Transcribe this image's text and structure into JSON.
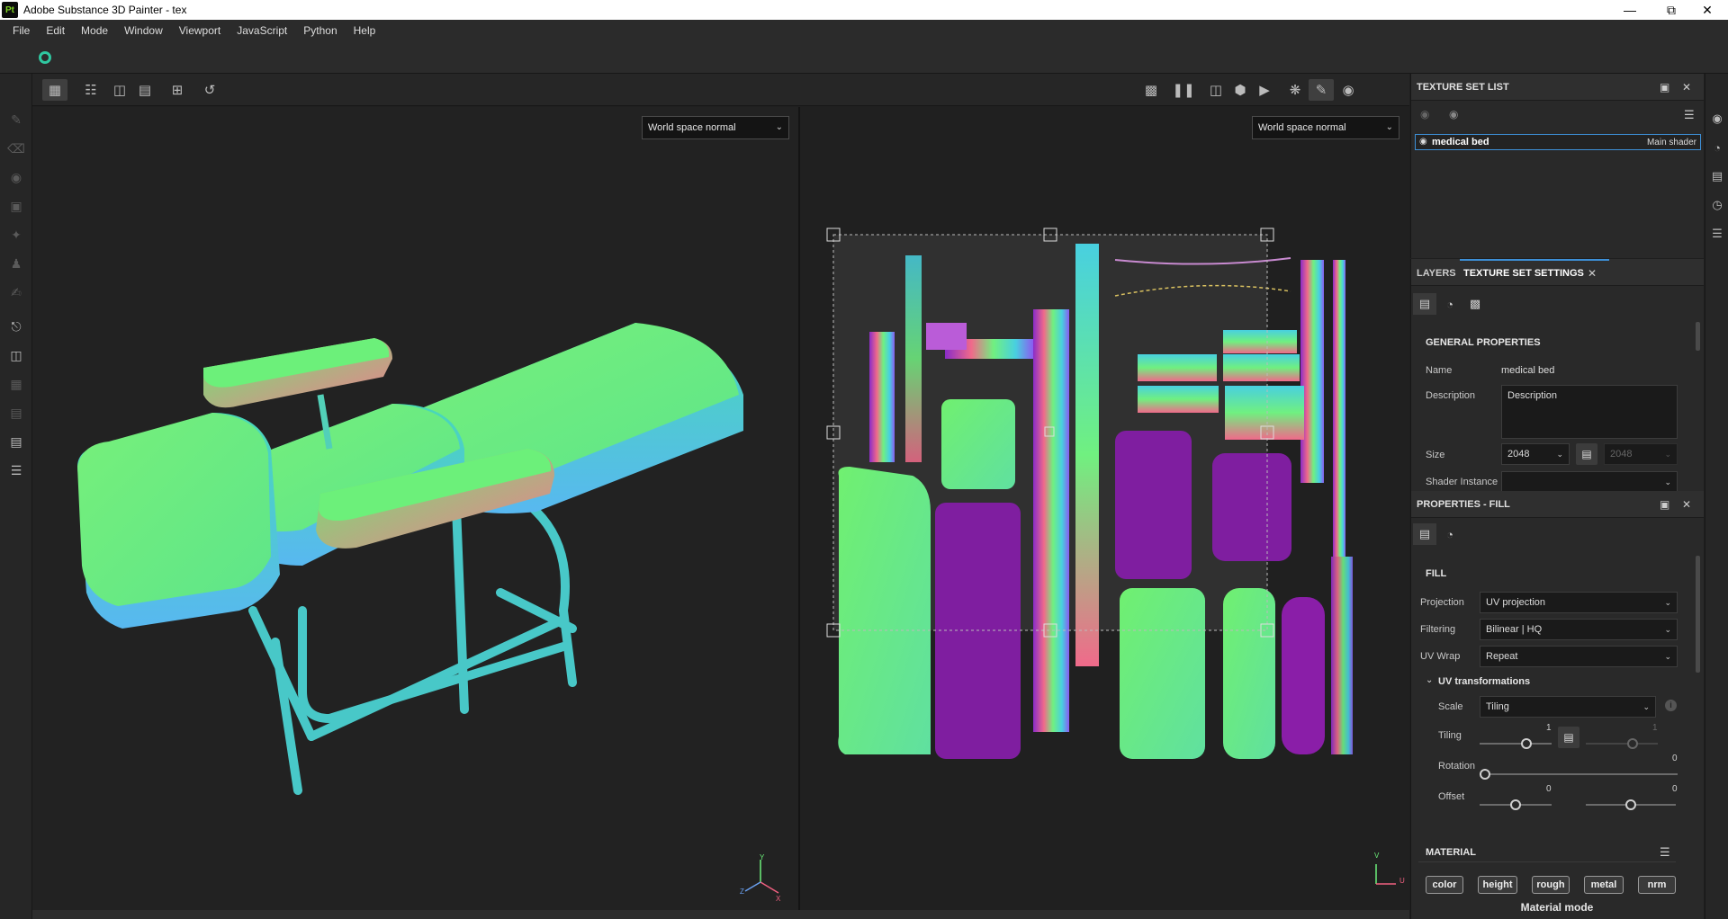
{
  "window": {
    "title": "Adobe Substance 3D Painter - tex",
    "logo_text": "Pt",
    "minimize_icon": "minimize-icon",
    "restore_icon": "restore-icon",
    "close_icon": "close-icon"
  },
  "menu": [
    "File",
    "Edit",
    "Mode",
    "Window",
    "Viewport",
    "JavaScript",
    "Python",
    "Help"
  ],
  "viewport": {
    "left_mode": "World space normal",
    "right_mode": "World space normal",
    "axis_labels": {
      "z": "Z",
      "y": "Y",
      "x": "X",
      "v": "V",
      "u": "U"
    }
  },
  "texture_set_list": {
    "title": "TEXTURE SET LIST",
    "item_name": "medical bed",
    "item_shader": "Main shader"
  },
  "tabs": {
    "layers": "LAYERS",
    "texture_set_settings": "TEXTURE SET SETTINGS"
  },
  "general_properties": {
    "title": "GENERAL PROPERTIES",
    "name_label": "Name",
    "name_value": "medical bed",
    "description_label": "Description",
    "description_placeholder": "Description",
    "size_label": "Size",
    "size_value": "2048",
    "size_value_locked": "2048",
    "shader_instance_label": "Shader Instance"
  },
  "properties_fill": {
    "title": "PROPERTIES - FILL",
    "fill_title": "FILL",
    "projection_label": "Projection",
    "projection_value": "UV projection",
    "filtering_label": "Filtering",
    "filtering_value": "Bilinear | HQ",
    "uvwrap_label": "UV Wrap",
    "uvwrap_value": "Repeat",
    "uv_transformations": "UV transformations",
    "scale_label": "Scale",
    "scale_value": "Tiling",
    "tiling_label": "Tiling",
    "tiling_value_1": "1",
    "tiling_value_2": "1",
    "rotation_label": "Rotation",
    "rotation_value": "0",
    "offset_label": "Offset",
    "offset_value_1": "0",
    "offset_value_2": "0"
  },
  "material": {
    "title": "MATERIAL",
    "channels": [
      "color",
      "height",
      "rough",
      "metal",
      "nrm"
    ],
    "mode_label": "Material mode"
  },
  "colors": {
    "accent": "#3d8fd6",
    "normal_green": "#6cf37e",
    "normal_purple": "#7f1ea0",
    "normal_pink": "#f27a86"
  }
}
